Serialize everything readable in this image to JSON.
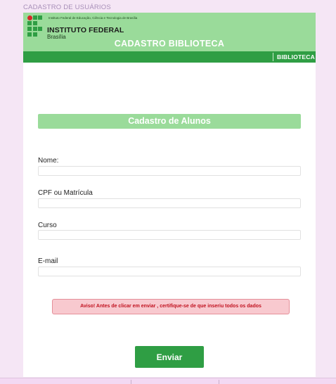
{
  "page": {
    "title": "CADASTRO DE USUÁRIOS"
  },
  "header": {
    "institution_small": "Instituto Federal de Educação, Ciência e Tecnologia de Brasília",
    "institution_name": "INSTITUTO FEDERAL",
    "institution_city": "Brasília",
    "title": "CADASTRO BIBLIOTECA"
  },
  "nav": {
    "link": "BIBLIOTECA"
  },
  "form": {
    "section_title": "Cadastro de Alunos",
    "fields": [
      {
        "label": "Nome:",
        "value": ""
      },
      {
        "label": "CPF ou Matrícula",
        "value": ""
      },
      {
        "label": "Curso",
        "value": ""
      },
      {
        "label": "E-mail",
        "value": ""
      }
    ],
    "warning": "Aviso! Antes de clicar em enviar , certifique-se de que inseriu todos os  dados",
    "submit_label": "Enviar"
  },
  "colors": {
    "header_green": "#9adb9a",
    "nav_green": "#2f9e44",
    "alert_bg": "#f8c9cf",
    "alert_text": "#c1121f",
    "page_bg": "#f5e6f5"
  },
  "icons": {
    "logo": "if-logo-grid-icon"
  }
}
